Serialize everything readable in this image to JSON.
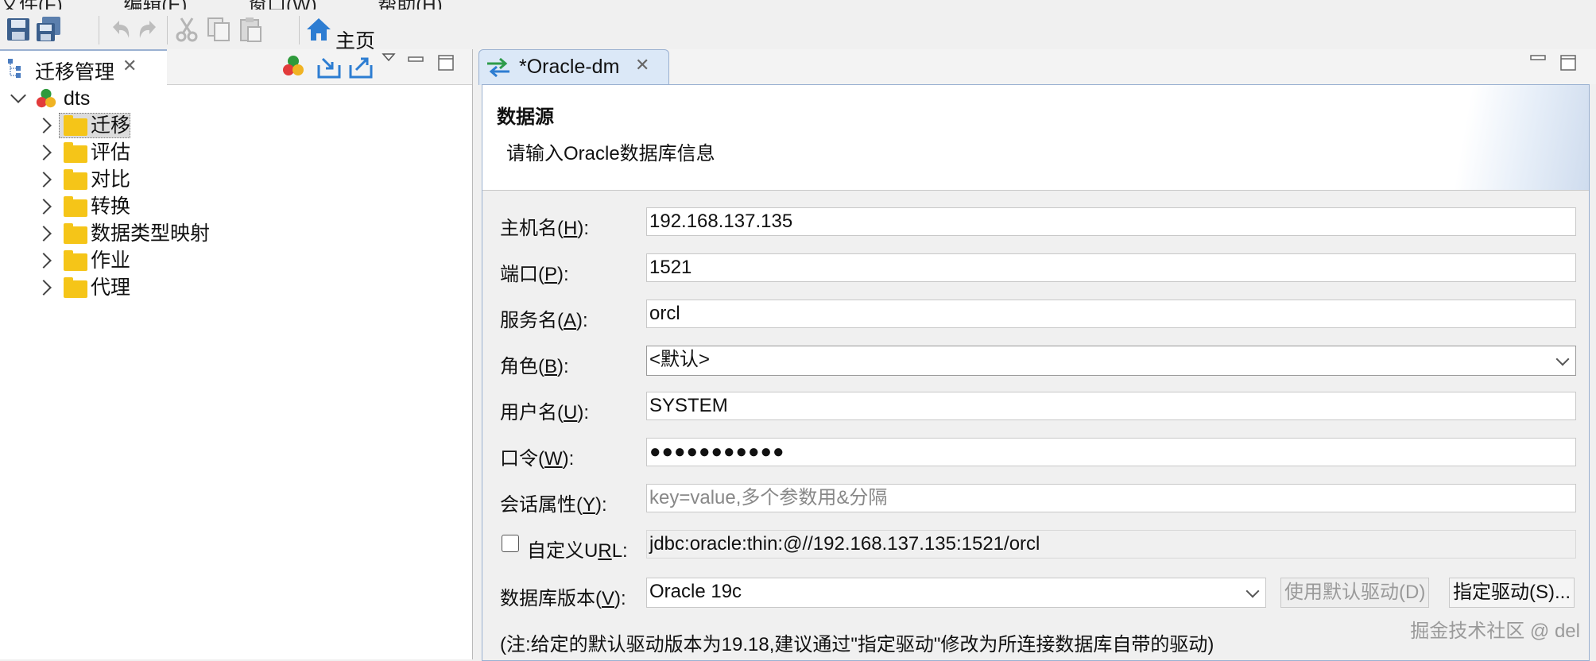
{
  "menu": [
    "文件(F)",
    "编辑(E)",
    "窗口(W)",
    "帮助(H)"
  ],
  "toolbar": {
    "home_label": "主页"
  },
  "left_view": {
    "tab_title": "迁移管理",
    "tree": {
      "root": "dts",
      "children": [
        "迁移",
        "评估",
        "对比",
        "转换",
        "数据类型映射",
        "作业",
        "代理"
      ]
    }
  },
  "editor": {
    "tab_title": "*Oracle-dm",
    "banner_title": "数据源",
    "banner_desc": "请输入Oracle数据库信息",
    "fields": {
      "host": {
        "label_pre": "主机名(",
        "mnemonic": "H",
        "label_post": "):",
        "value": "192.168.137.135"
      },
      "port": {
        "label_pre": "端口(",
        "mnemonic": "P",
        "label_post": "):",
        "value": "1521"
      },
      "service": {
        "label_pre": "服务名(",
        "mnemonic": "A",
        "label_post": "):",
        "value": "orcl"
      },
      "role": {
        "label_pre": "角色(",
        "mnemonic": "B",
        "label_post": "):",
        "value": "<默认>"
      },
      "user": {
        "label_pre": "用户名(",
        "mnemonic": "U",
        "label_post": "):",
        "value": "SYSTEM"
      },
      "password": {
        "label_pre": "口令(",
        "mnemonic": "W",
        "label_post": "):",
        "value": "●●●●●●●●●●●"
      },
      "session": {
        "label_pre": "会话属性(",
        "mnemonic": "Y",
        "label_post": "):",
        "placeholder": "key=value,多个参数用&分隔"
      },
      "url": {
        "label_pre": "自定义U",
        "mnemonic": "R",
        "label_post": "L:",
        "value": "jdbc:oracle:thin:@//192.168.137.135:1521/orcl",
        "checked": false
      },
      "db_version": {
        "label_pre": "数据库版本(",
        "mnemonic": "V",
        "label_post": "):",
        "value": "Oracle 19c"
      }
    },
    "buttons": {
      "default_driver": "使用默认驱动(D)",
      "specify_driver": "指定驱动(S)..."
    },
    "note": "(注:给定的默认驱动版本为19.18,建议通过\"指定驱动\"修改为所连接数据库自带的驱动)"
  },
  "watermark": "掘金技术社区 @ del",
  "colors": {
    "folder": "#f5c518",
    "tab_active_bg": "#dbe8f7",
    "home_icon": "#2d7dd2"
  }
}
